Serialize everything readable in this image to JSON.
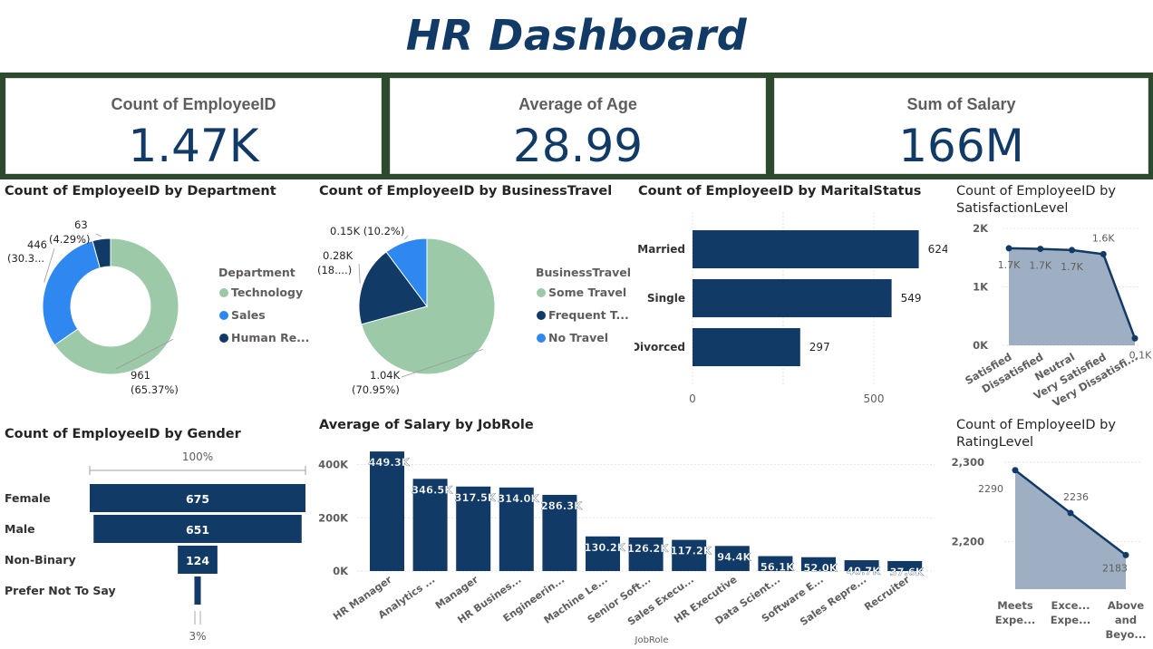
{
  "header": {
    "title": "HR Dashboard"
  },
  "kpis": [
    {
      "label": "Count of EmployeeID",
      "value": "1.47K"
    },
    {
      "label": "Average of Age",
      "value": "28.99"
    },
    {
      "label": "Sum of Salary",
      "value": "166M"
    }
  ],
  "colors": {
    "dark_blue": "#123A66",
    "bright_blue": "#2F88F0",
    "sage": "#9CC9A8",
    "area": "#9EAFC4",
    "kpi_border": "#2D4A2F"
  },
  "chart_data": [
    {
      "id": "department",
      "type": "pie",
      "subtype": "donut",
      "title": "Count of EmployeeID by Department",
      "legend_title": "Department",
      "legend_position": "right",
      "slices": [
        {
          "name": "Technology",
          "value": 961,
          "label": "961",
          "pct": "(65.37%)",
          "color": "#9CC9A8"
        },
        {
          "name": "Sales",
          "value": 446,
          "label": "446",
          "pct": "(30.3...",
          "color": "#2F88F0"
        },
        {
          "name": "Human Resources",
          "value": 63,
          "label": "63",
          "pct": "(4.29%)",
          "color": "#123A66"
        }
      ],
      "legend_labels": [
        "Technology",
        "Sales",
        "Human Re..."
      ]
    },
    {
      "id": "business_travel",
      "type": "pie",
      "title": "Count of EmployeeID by BusinessTravel",
      "legend_title": "BusinessTravel",
      "legend_position": "right",
      "slices": [
        {
          "name": "Some Travel",
          "value": 1040,
          "label": "1.04K",
          "pct": "(70.95%)",
          "color": "#9CC9A8"
        },
        {
          "name": "Frequent Traveller",
          "value": 280,
          "label": "0.28K",
          "pct": "(18....)",
          "color": "#123A66"
        },
        {
          "name": "No Travel",
          "value": 150,
          "label": "0.15K (10.2%)",
          "pct": "",
          "color": "#2F88F0"
        }
      ],
      "legend_labels": [
        "Some Travel",
        "Frequent T...",
        "No Travel"
      ]
    },
    {
      "id": "marital",
      "type": "bar",
      "orientation": "horizontal",
      "title": "Count of EmployeeID by MaritalStatus",
      "categories": [
        "Married",
        "Single",
        "Divorced"
      ],
      "values": [
        624,
        549,
        297
      ],
      "xlim": [
        0,
        650
      ],
      "xticks": [
        "0",
        "500"
      ],
      "grid": true
    },
    {
      "id": "satisfaction",
      "type": "area",
      "title": "Count of EmployeeID by SatisfactionLevel",
      "categories": [
        "Satisfied",
        "Dissatisfied",
        "Neutral",
        "Very Satisfied",
        "Very Dissatisfi..."
      ],
      "values": [
        1660,
        1650,
        1630,
        1560,
        120
      ],
      "labels": [
        "1.7K",
        "1.7K",
        "1.7K",
        "1.6K",
        "0.1K"
      ],
      "ylim": [
        0,
        2000
      ],
      "yticks": [
        "2K",
        "1K",
        "0K"
      ],
      "grid": true
    },
    {
      "id": "gender",
      "type": "bar",
      "subtype": "funnel",
      "title": "Count of EmployeeID by Gender",
      "categories": [
        "Female",
        "Male",
        "Non-Binary",
        "Prefer Not To Say"
      ],
      "values": [
        675,
        651,
        124,
        20
      ],
      "labels": [
        "675",
        "651",
        "124",
        ""
      ],
      "top_label": "100%",
      "bottom_label": "3%"
    },
    {
      "id": "jobrole",
      "type": "bar",
      "title": "Average of Salary by JobRole",
      "xlabel": "JobRole",
      "categories": [
        "HR Manager",
        "Analytics ...",
        "Manager",
        "HR Busines...",
        "Engineerin...",
        "Machine Le...",
        "Senior Soft...",
        "Sales Execu...",
        "HR Executive",
        "Data Scient...",
        "Software E...",
        "Sales Repre...",
        "Recruiter"
      ],
      "values": [
        449300,
        346500,
        317500,
        314000,
        286300,
        130200,
        126200,
        117200,
        94400,
        56100,
        52000,
        40700,
        37600
      ],
      "labels": [
        "449.3K",
        "346.5K",
        "317.5K",
        "314.0K",
        "286.3K",
        "130.2K",
        "126.2K",
        "117.2K",
        "94.4K",
        "56.1K",
        "52.0K",
        "40.7K",
        "37.6K"
      ],
      "ylim": [
        0,
        470000
      ],
      "yticks": [
        "400K",
        "200K",
        "0K"
      ],
      "grid": true
    },
    {
      "id": "rating",
      "type": "area",
      "title": "Count of EmployeeID by RatingLevel",
      "categories": [
        [
          "Meets",
          "Expe..."
        ],
        [
          "Exce...",
          "Expe..."
        ],
        [
          "Above",
          "and",
          "Beyo..."
        ]
      ],
      "values": [
        2290,
        2236,
        2183
      ],
      "labels": [
        "2290",
        "2236",
        "2183"
      ],
      "ylim": [
        2140,
        2300
      ],
      "yticks": [
        "2,300",
        "2,200"
      ],
      "grid": true
    }
  ]
}
